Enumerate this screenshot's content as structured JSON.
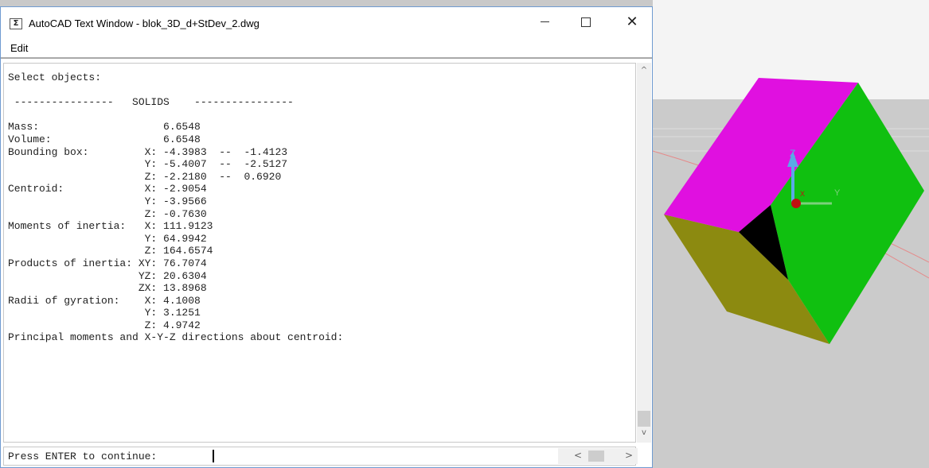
{
  "window": {
    "title": "AutoCAD Text Window - blok_3D_d+StDev_2.dwg",
    "icon_glyph": "Σ",
    "close_glyph": "✕"
  },
  "menu": {
    "edit_label": "Edit"
  },
  "console": {
    "lines": [
      "Select objects:",
      "",
      " ----------------   SOLIDS    ----------------",
      "",
      "Mass:                    6.6548",
      "Volume:                  6.6548",
      "Bounding box:         X: -4.3983  --  -1.4123",
      "                      Y: -5.4007  --  -2.5127",
      "                      Z: -2.2180  --  0.6920",
      "Centroid:             X: -2.9054",
      "                      Y: -3.9566",
      "                      Z: -0.7630",
      "Moments of inertia:   X: 111.9123",
      "                      Y: 64.9942",
      "                      Z: 164.6574",
      "Products of inertia: XY: 76.7074",
      "                     YZ: 20.6304",
      "                     ZX: 13.8968",
      "Radii of gyration:    X: 4.1008",
      "                      Y: 3.1251",
      "                      Z: 4.9742",
      "Principal moments and X-Y-Z directions about centroid:"
    ]
  },
  "prompt": "Press ENTER to continue: ",
  "scroll": {
    "up": "^",
    "down": "v",
    "left": "<",
    "right": ">"
  },
  "viewport": {
    "axis_labels": {
      "z": "Z",
      "y": "Y",
      "x": "X"
    },
    "colors": {
      "top_face": "#e010e0",
      "right_face": "#10c010",
      "left_face": "#8c8a10",
      "inner_face": "#000000",
      "background_upper": "#ffffff",
      "background_lower": "#c7c7c7"
    }
  }
}
